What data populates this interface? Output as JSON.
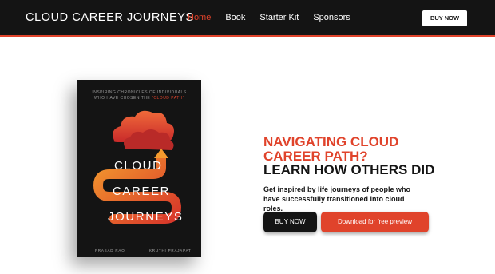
{
  "header": {
    "brand": "CLOUD CAREER JOURNEYS",
    "nav": [
      {
        "label": "Home"
      },
      {
        "label": "Book"
      },
      {
        "label": "Starter Kit"
      },
      {
        "label": "Sponsors"
      }
    ],
    "buy_label": "BUY NOW"
  },
  "book": {
    "tagline_1": "INSPIRING CHRONICLES OF INDIVIDUALS",
    "tagline_2": "WHO HAVE CHOSEN THE",
    "tagline_highlight": "\"CLOUD PATH\"",
    "title_1": "CLOUD",
    "title_2": "CAREER",
    "title_3": "JOURNEYS",
    "author_1": "PRASAD RAO",
    "author_2": "KRUTHI PRAJAPATI"
  },
  "hero": {
    "headline_1": "NAVIGATING CLOUD",
    "headline_2": "CAREER PATH?",
    "headline_3": "LEARN HOW OTHERS DID",
    "subtext": "Get inspired by life journeys of people who have successfully transitioned into cloud roles.",
    "buy_label": "BUY NOW",
    "preview_label": "Download for free preview"
  },
  "colors": {
    "accent": "#e0432b",
    "dark": "#141414",
    "background": "#ffffff"
  }
}
